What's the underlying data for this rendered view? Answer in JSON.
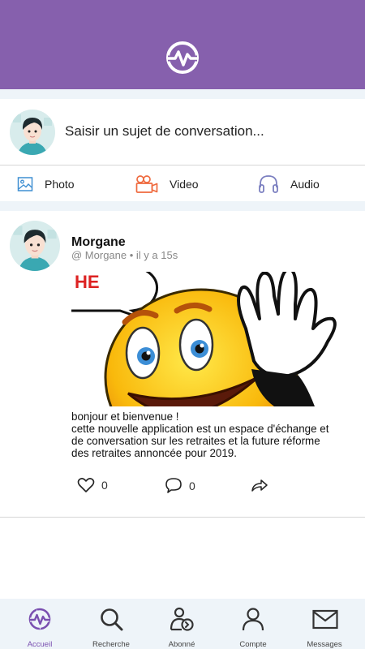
{
  "colors": {
    "brand": "#8660ad",
    "accent_video": "#ef6a3e",
    "accent_audio": "#7b7fc0",
    "bg_gap": "#eef4f9"
  },
  "header": {
    "logo_icon": "pulse-circle-icon"
  },
  "composer": {
    "placeholder": "Saisir un sujet de conversation..."
  },
  "media": {
    "photo_label": "Photo",
    "video_label": "Video",
    "audio_label": "Audio"
  },
  "post": {
    "author": "Morgane",
    "meta": "@ Morgane • il y a 15s",
    "image_alt": "smiley waving hello",
    "text_lines": [
      "bonjour et bienvenue !",
      "cette nouvelle application est un espace d'échange et",
      "de conversation sur les retraites et la future réforme",
      "des retraites annoncée pour 2019."
    ],
    "likes": "0",
    "comments": "0"
  },
  "nav": {
    "items": [
      {
        "label": "Accueil"
      },
      {
        "label": "Recherche"
      },
      {
        "label": "Abonné"
      },
      {
        "label": "Compte"
      },
      {
        "label": "Messages"
      }
    ]
  }
}
